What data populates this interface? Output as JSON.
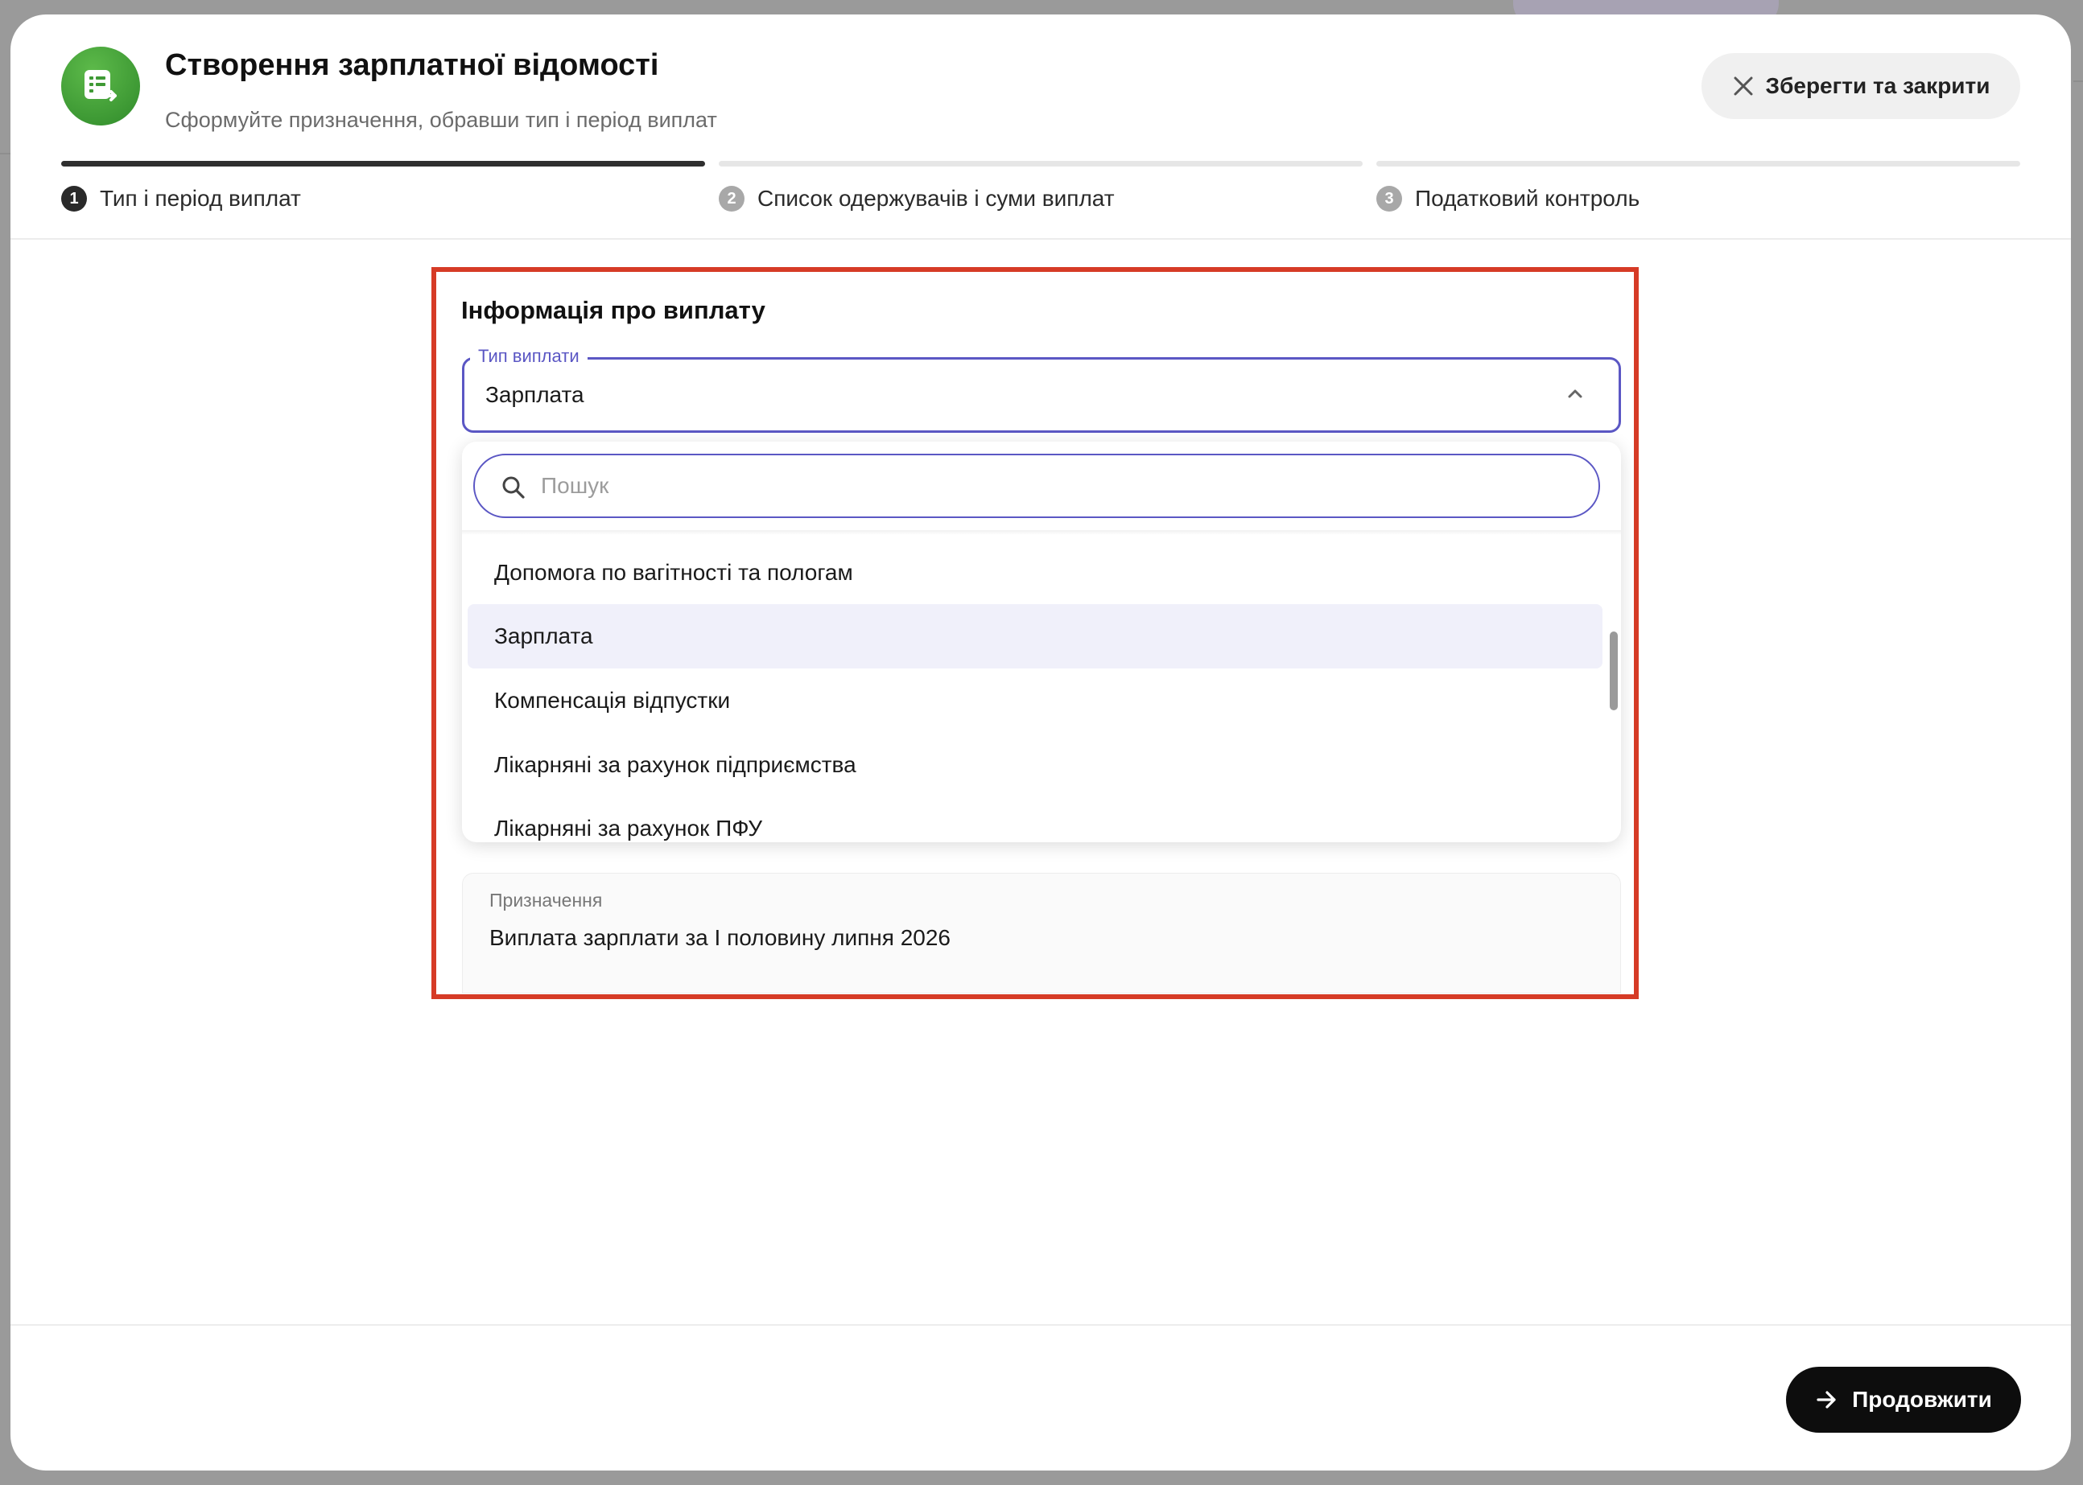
{
  "modal": {
    "title": "Створення зарплатної відомості",
    "subtitle": "Сформуйте призначення, обравши тип і період виплат",
    "save_close_label": "Зберегти та закрити",
    "logo_icon": "payroll-document-icon",
    "brand_color": "#3f9a35"
  },
  "steps": [
    {
      "number": "1",
      "label": "Тип і період виплат",
      "active": true
    },
    {
      "number": "2",
      "label": "Список одержувачів і суми виплат",
      "active": false
    },
    {
      "number": "3",
      "label": "Податковий контроль",
      "active": false
    }
  ],
  "form": {
    "section_title": "Інформація про виплату",
    "payment_type": {
      "label": "Тип виплати",
      "value": "Зарплата",
      "accent_color": "#5b57c4"
    },
    "dropdown": {
      "search_placeholder": "Пошук",
      "options": [
        {
          "label": "Допомога по вагітності та пологам",
          "selected": false
        },
        {
          "label": "Зарплата",
          "selected": true
        },
        {
          "label": "Компенсація відпустки",
          "selected": false
        },
        {
          "label": "Лікарняні за рахунок підприємства",
          "selected": false
        },
        {
          "label": "Лікарняні за рахунок ПФУ",
          "selected": false
        }
      ]
    },
    "purpose": {
      "label": "Призначення",
      "value": "Виплата зарплати за І половину липня 2026"
    }
  },
  "footer": {
    "continue_label": "Продовжити"
  },
  "highlight_color": "#d63b26"
}
